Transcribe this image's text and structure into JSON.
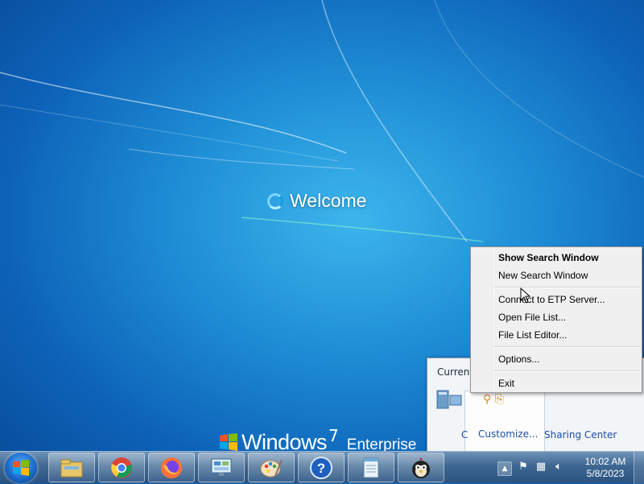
{
  "desktop": {
    "welcome_text": "Welcome",
    "brand": {
      "name": "Windows",
      "version": "7",
      "edition": "Enterprise"
    }
  },
  "tray_popup": {
    "header": "Current",
    "customize_link": "Customize...",
    "sharing_link": "Sharing Center",
    "c_fragment": "C"
  },
  "context_menu": {
    "items": [
      {
        "label": "Show Search Window",
        "bold": true
      },
      {
        "label": "New Search Window"
      },
      {
        "label": "Connect to ETP Server..."
      },
      {
        "label": "Open File List..."
      },
      {
        "label": "File List Editor..."
      },
      {
        "label": "Options..."
      },
      {
        "label": "Exit"
      }
    ]
  },
  "taskbar": {
    "pinned": [
      "explorer",
      "chrome",
      "firefox",
      "control-panel",
      "paint",
      "help",
      "notepad",
      "angry-bird"
    ],
    "clock": {
      "time": "10:02 AM",
      "date": "5/8/2023"
    },
    "tray_icons": [
      "show-hidden-icons",
      "action-center-icon",
      "network-icon",
      "volume-icon"
    ]
  },
  "colors": {
    "desktop_blue": "#1f8fd6",
    "link_blue": "#1c4fa6"
  }
}
